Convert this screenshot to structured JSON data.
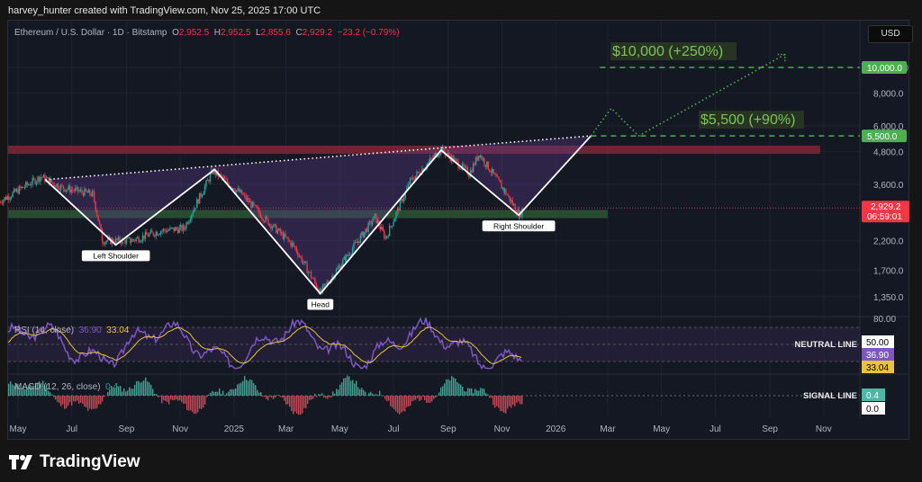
{
  "credit": "harvey_hunter created with TradingView.com, Nov 25, 2025 17:00 UTC",
  "legend": {
    "symbol": "Ethereum / U.S. Dollar · 1D · Bitstamp",
    "o_label": "O",
    "o": "2,952.5",
    "h_label": "H",
    "h": "2,952.5",
    "l_label": "L",
    "l": "2,855.6",
    "c_label": "C",
    "c": "2,929.2",
    "change": "−23.2 (−0.79%)"
  },
  "currency_button": "USD",
  "footer_brand": "TradingView",
  "colors": {
    "background": "#141823",
    "up": "#26a69a",
    "down": "#f23645",
    "rsi": "#7e57c2",
    "rsi_ma": "#e8c43a",
    "target": "#4caf50",
    "pattern": "#ffffff",
    "resistance_zone": "#8b2a3a",
    "support_zone": "#2f5e34"
  },
  "chart_data": {
    "type": "candlestick",
    "scale": "log",
    "ylim": [
      1200,
      13000
    ],
    "price_ticks": [
      "10,000.0",
      "8,000.0",
      "6,000.0",
      "4,800.0",
      "3,600.0",
      "2,200.0",
      "1,700.0",
      "1,350.0"
    ],
    "x_ticks": [
      {
        "label": "May",
        "date": "2024-05-01"
      },
      {
        "label": "Jul",
        "date": "2024-07-01"
      },
      {
        "label": "Sep",
        "date": "2024-09-01"
      },
      {
        "label": "Nov",
        "date": "2024-11-01"
      },
      {
        "label": "2025",
        "date": "2025-01-01"
      },
      {
        "label": "Mar",
        "date": "2025-03-01"
      },
      {
        "label": "May",
        "date": "2025-05-01"
      },
      {
        "label": "Jul",
        "date": "2025-07-01"
      },
      {
        "label": "Sep",
        "date": "2025-09-01"
      },
      {
        "label": "Nov",
        "date": "2025-11-01"
      },
      {
        "label": "2026",
        "date": "2026-01-01"
      },
      {
        "label": "Mar",
        "date": "2026-03-01"
      },
      {
        "label": "May",
        "date": "2026-05-01"
      },
      {
        "label": "Jul",
        "date": "2026-07-01"
      },
      {
        "label": "Sep",
        "date": "2026-09-01"
      },
      {
        "label": "Nov",
        "date": "2026-11-01"
      }
    ],
    "price_path": [
      [
        "2024-04-10",
        3100
      ],
      [
        "2024-05-27",
        3850
      ],
      [
        "2024-06-20",
        3500
      ],
      [
        "2024-07-25",
        3300
      ],
      [
        "2024-08-05",
        2200
      ],
      [
        "2024-09-06",
        2200
      ],
      [
        "2024-10-10",
        2400
      ],
      [
        "2024-11-05",
        2450
      ],
      [
        "2024-12-08",
        4050
      ],
      [
        "2025-01-10",
        3300
      ],
      [
        "2025-02-03",
        2700
      ],
      [
        "2025-03-10",
        2100
      ],
      [
        "2025-04-09",
        1400
      ],
      [
        "2025-05-08",
        1900
      ],
      [
        "2025-06-10",
        2700
      ],
      [
        "2025-06-22",
        2250
      ],
      [
        "2025-07-20",
        3700
      ],
      [
        "2025-08-24",
        4900
      ],
      [
        "2025-09-25",
        3950
      ],
      [
        "2025-10-06",
        4700
      ],
      [
        "2025-11-04",
        3400
      ],
      [
        "2025-11-21",
        2750
      ],
      [
        "2025-11-25",
        2929.2
      ]
    ],
    "last_price": {
      "value": "2,929.2",
      "countdown": "06:59:01"
    },
    "pattern": {
      "points": [
        [
          "2024-06-01",
          3750
        ],
        [
          "2024-08-20",
          2120
        ],
        [
          "2024-12-10",
          4100
        ],
        [
          "2025-04-09",
          1385
        ],
        [
          "2025-08-24",
          4850
        ],
        [
          "2025-11-20",
          2750
        ],
        [
          "2026-02-10",
          5500
        ]
      ],
      "labels": [
        "Left Shoulder",
        "Head",
        "Right Shoulder"
      ],
      "neckline": [
        [
          "2024-06-01",
          3750
        ],
        [
          "2026-02-10",
          5500
        ]
      ]
    },
    "projection": [
      [
        "2026-02-10",
        5500
      ],
      [
        "2026-03-05",
        7000
      ],
      [
        "2026-04-05",
        5500
      ],
      [
        "2026-09-18",
        11200
      ]
    ],
    "zones": [
      {
        "type": "resistance",
        "from": 4700,
        "to": 5050,
        "start": "2024-04-01",
        "end": "2026-10-28"
      },
      {
        "type": "support",
        "from": 2680,
        "to": 2880,
        "start": "2024-04-01",
        "end": "2026-03-01"
      }
    ],
    "targets": [
      {
        "value": 10000,
        "label": "$10,000 (+250%)",
        "axis_label": "10,000.0"
      },
      {
        "value": 5500,
        "label": "$5,500 (+90%)",
        "axis_label": "5,500.0"
      }
    ],
    "rsi": {
      "label": "RSI (14, close)",
      "value": "36.90",
      "ma": "33.04",
      "top_tick": "80.00",
      "neutral": "50.00",
      "neutral_label": "NEUTRAL LINE"
    },
    "macd": {
      "label": "MACD (12, 26, close)",
      "value": "0.4",
      "zero": "0.0",
      "signal_label": "SIGNAL LINE"
    }
  }
}
